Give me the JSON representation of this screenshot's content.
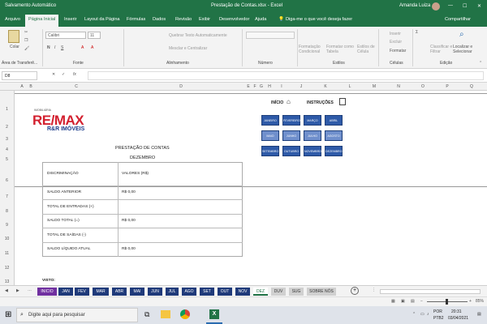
{
  "title": {
    "autosave": "Salvamento Automático",
    "doc": "Prestação de Contas.xlsx - Excel",
    "user": "Amanda Luiza"
  },
  "menu": [
    "Arquivo",
    "Página Inicial",
    "Inserir",
    "Layout da Página",
    "Fórmulas",
    "Dados",
    "Revisão",
    "Exibir",
    "Desenvolvedor",
    "Ajuda"
  ],
  "tellme": "Diga-me o que você deseja fazer",
  "share": "Compartilhar",
  "ribbon": {
    "paste": "Colar",
    "clipboard": "Área de Transferê...",
    "font_name": "Calibri",
    "font_size": "11",
    "font_group": "Fonte",
    "wrap": "Quebrar Texto Automaticamente",
    "merge": "Mesclar e Centralizar",
    "align_group": "Alinhamento",
    "number_group": "Número",
    "cond_format": "Formatação Condicional",
    "format_table": "Formatar como Tabela",
    "cell_styles": "Estilos de Célula",
    "styles_group": "Estilos",
    "insert": "Inserir",
    "delete": "Excluir",
    "format": "Formatar",
    "cells_group": "Células",
    "sort": "Classificar e Filtrar",
    "find": "Localizar e Selecionar",
    "edit_group": "Edição"
  },
  "namebox": "D8",
  "columns": [
    "A",
    "B",
    "C",
    "D",
    "E",
    "F",
    "G",
    "H",
    "I",
    "J",
    "K",
    "L",
    "M",
    "N",
    "O",
    "P",
    "Q"
  ],
  "rows": [
    "1",
    "2",
    "3",
    "4",
    "5",
    "6",
    "7",
    "8",
    "9",
    "10",
    "11",
    "12",
    "13"
  ],
  "logo": {
    "brand": "RE/MAX",
    "sub": "R&R IMÓVEIS",
    "tag": "IMOBILIÁRIA"
  },
  "nav": {
    "inicio": "INÍCIO",
    "instrucoes": "INSTRUÇÕES"
  },
  "months_btn": [
    "JANEIRO",
    "FEVEREIRO",
    "MARÇO",
    "ABRIL",
    "MAIO",
    "JUNHO",
    "JULHO",
    "AGOSTO",
    "SETEMBRO",
    "OUTUBRO",
    "NOVEMBRO",
    "DEZEMBRO"
  ],
  "sheet": {
    "heading": "PRESTAÇÃO DE CONTAS",
    "month": "DEZEMBRO",
    "col1": "DISCRIMINAÇÃO",
    "col2": "VALORES (R$)",
    "rows": [
      {
        "label": "SALDO ANTERIOR",
        "value": "R$ 0,00"
      },
      {
        "label": "TOTAL DE ENTRADAS (+)",
        "value": ""
      },
      {
        "label": "SALDO TOTAL (=)",
        "value": "R$ 0,00"
      },
      {
        "label": "TOTAL DE SAÍDAS (-)",
        "value": ""
      },
      {
        "label": "SALDO LÍQUIDO ATUAL",
        "value": "R$ 0,00"
      }
    ],
    "visto": "VISTO:"
  },
  "tabs": [
    "INICIO",
    "JAN",
    "FEV",
    "MAR",
    "ABR",
    "MAI",
    "JUN",
    "JUL",
    "AGO",
    "SET",
    "OUT",
    "NOV",
    "DEZ",
    "DUV",
    "SUG",
    "SOBRE NÓS"
  ],
  "zoom": "85%",
  "taskbar": {
    "search": "Digite aqui para pesquisar",
    "lang": "POR",
    "kbd": "PTB2",
    "time": "20:31",
    "date": "03/04/2021"
  }
}
